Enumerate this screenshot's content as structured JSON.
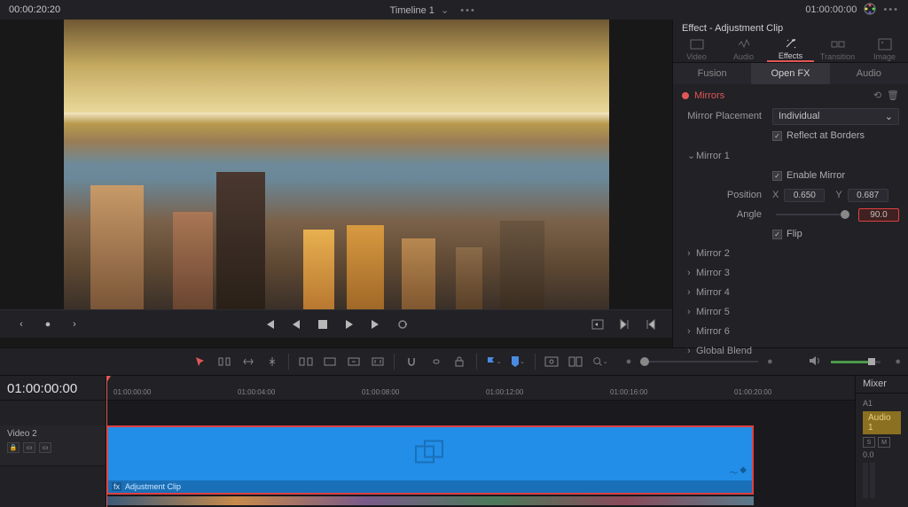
{
  "topbar": {
    "timecode_left": "00:00:20:20",
    "timeline_name": "Timeline 1",
    "timecode_right": "01:00:00:00"
  },
  "inspector": {
    "title": "Effect - Adjustment Clip",
    "tabs": [
      "Video",
      "Audio",
      "Effects",
      "Transition",
      "Image"
    ],
    "subtabs": [
      "Fusion",
      "Open FX",
      "Audio"
    ],
    "effect_name": "Mirrors",
    "placement_label": "Mirror Placement",
    "placement_value": "Individual",
    "reflect_label": "Reflect at Borders",
    "mirror1_label": "Mirror 1",
    "enable_label": "Enable Mirror",
    "position_label": "Position",
    "pos_x_label": "X",
    "pos_x": "0.650",
    "pos_y_label": "Y",
    "pos_y": "0.687",
    "angle_label": "Angle",
    "angle": "90.0",
    "flip_label": "Flip",
    "mirrors": [
      "Mirror 2",
      "Mirror 3",
      "Mirror 4",
      "Mirror 5",
      "Mirror 6"
    ],
    "global_blend": "Global Blend"
  },
  "timeline": {
    "current_tc": "01:00:00:00",
    "track_name": "Video 2",
    "ruler_marks": [
      "01:00:00:00",
      "01:00:04:00",
      "01:00:08:00",
      "01:00:12:00",
      "01:00:16:00",
      "01:00:20:00"
    ],
    "clip_name": "Adjustment Clip"
  },
  "mixer": {
    "title": "Mixer",
    "a1": "A1",
    "audio1": "Audio 1",
    "s": "S",
    "m": "M",
    "db": "0.0"
  }
}
